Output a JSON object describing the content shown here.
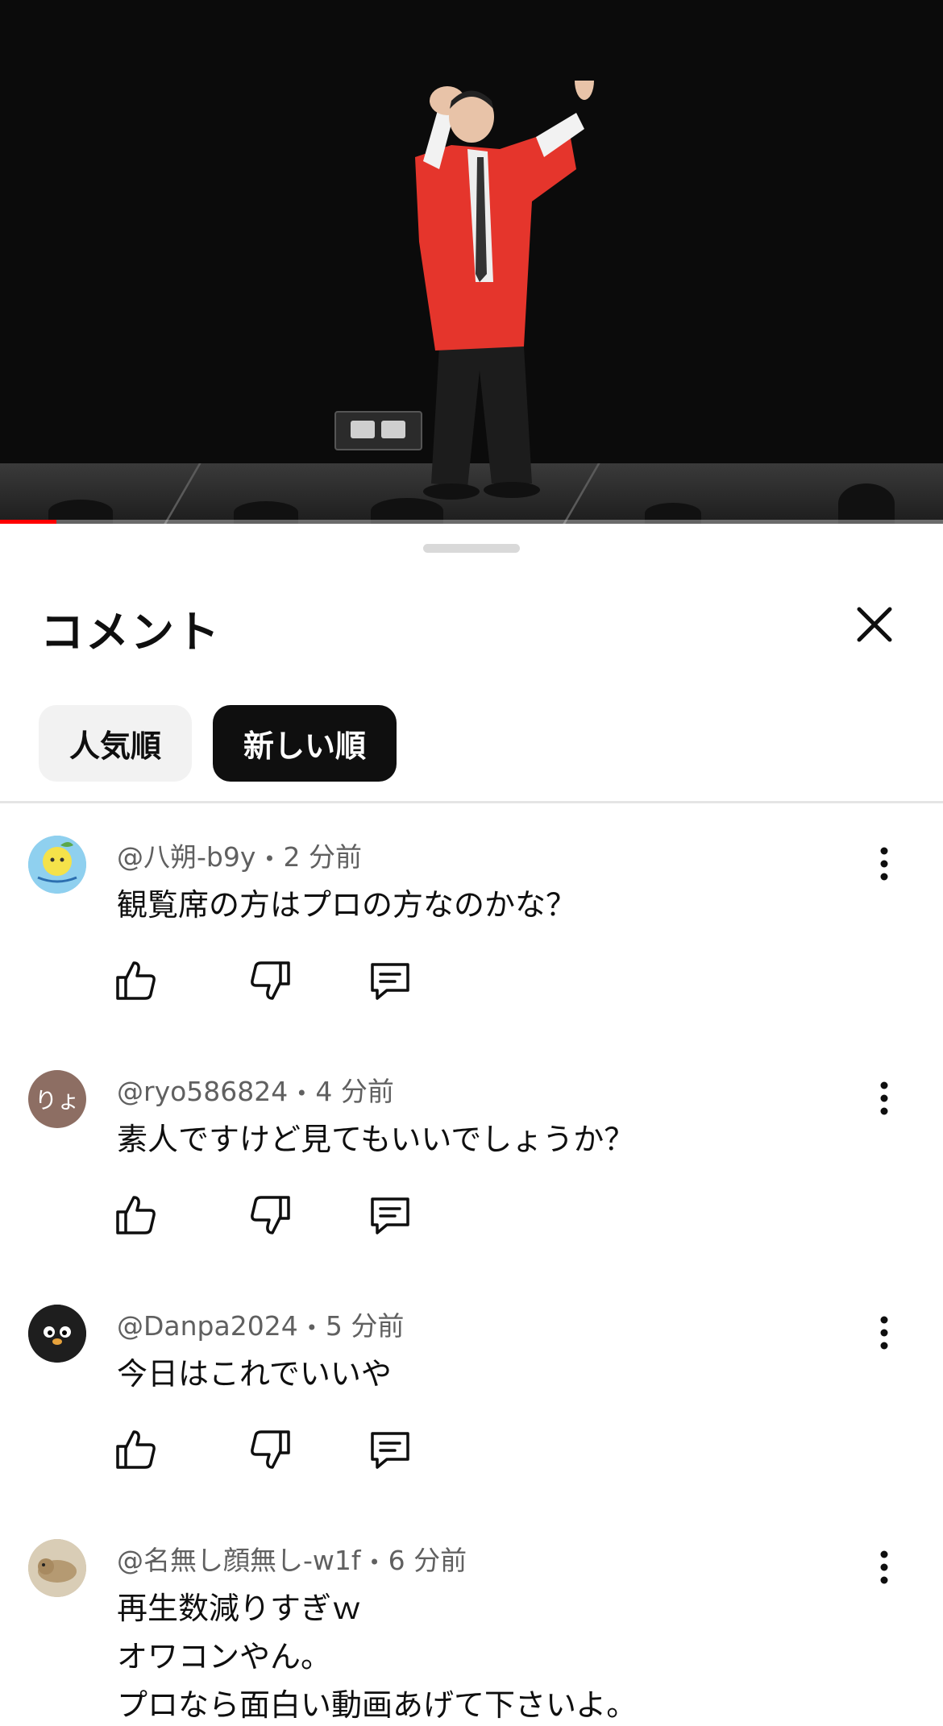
{
  "video": {
    "progress_fraction": 0.06,
    "accent_color": "#ff0000"
  },
  "comments_panel": {
    "title": "コメント",
    "close_icon": "close-icon",
    "sort_chips": [
      {
        "label": "人気順",
        "selected": false
      },
      {
        "label": "新しい順",
        "selected": true
      }
    ]
  },
  "comments": [
    {
      "handle": "@八朔-b9y",
      "separator": "•",
      "time": "2 分前",
      "avatar_text": "",
      "avatar_color": "#7fc6e8",
      "lines": [
        "観覧席の方はプロの方なのかな？"
      ]
    },
    {
      "handle": "@ryo586824",
      "separator": "•",
      "time": "4 分前",
      "avatar_text": "りょ",
      "avatar_color": "#8d6e63",
      "lines": [
        "素人ですけど見てもいいでしょうか？"
      ]
    },
    {
      "handle": "@Danpa2024",
      "separator": "•",
      "time": "5 分前",
      "avatar_text": "",
      "avatar_color": "#1b1b1b",
      "lines": [
        "今日はこれでいいや"
      ]
    },
    {
      "handle": "@名無し顔無し-w1f",
      "separator": "•",
      "time": "6 分前",
      "avatar_text": "",
      "avatar_color": "#c9b89a",
      "lines": [
        "再生数減りすぎｗ",
        "オワコンやん。",
        "プロなら面白い動画あげて下さいよ。"
      ]
    }
  ]
}
